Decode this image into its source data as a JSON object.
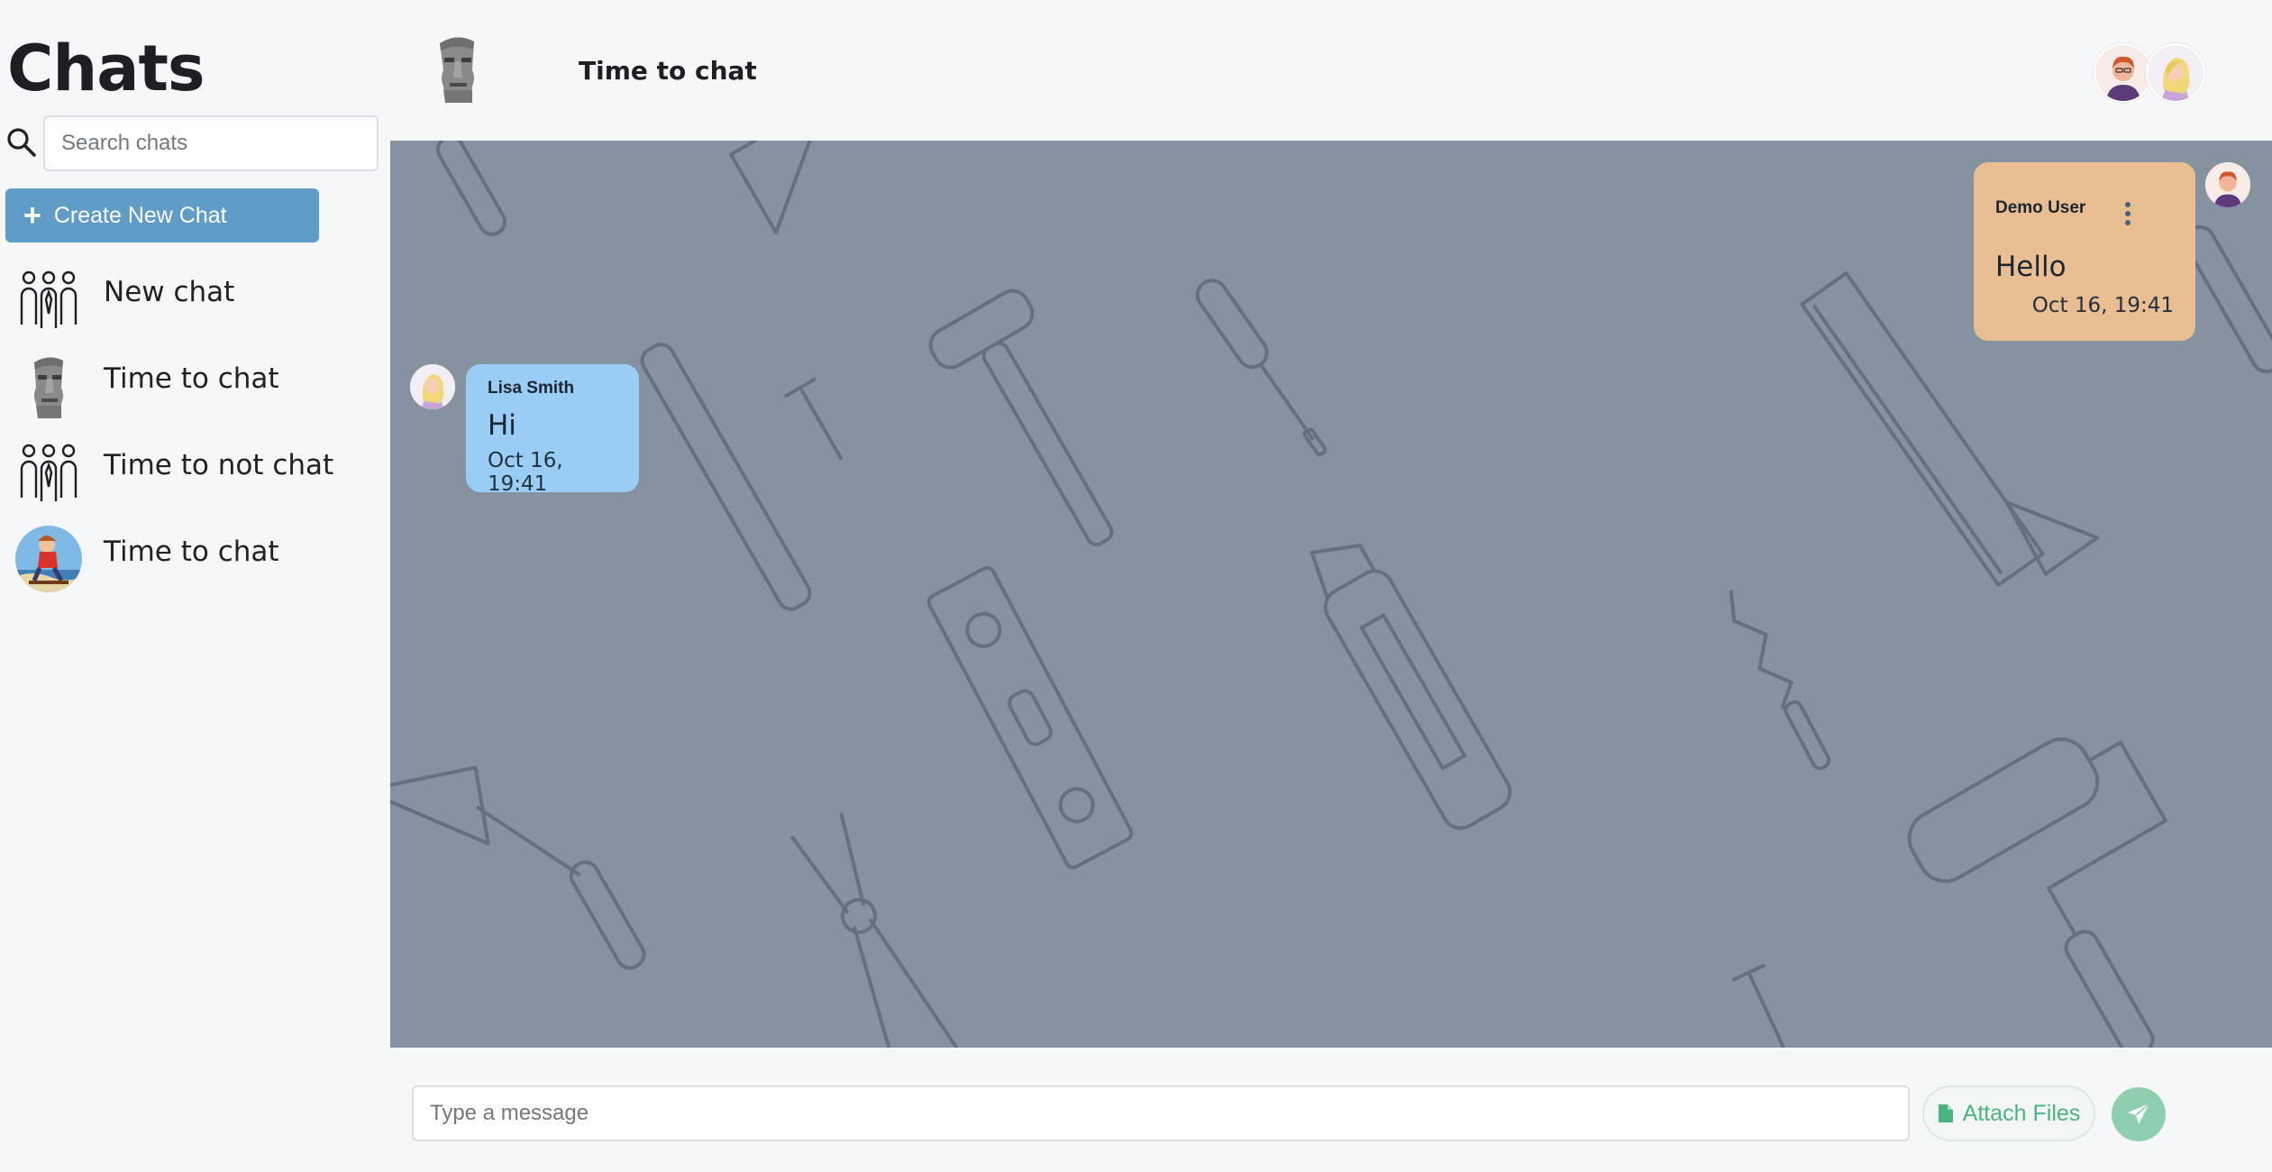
{
  "sidebar": {
    "title": "Chats",
    "search": {
      "placeholder": "Search chats",
      "value": ""
    },
    "create_button_label": "Create New Chat",
    "chats": [
      {
        "label": "New chat",
        "icon": "group-icon"
      },
      {
        "label": "Time to chat",
        "icon": "moai-icon"
      },
      {
        "label": "Time to not chat",
        "icon": "group-icon"
      },
      {
        "label": "Time to chat",
        "icon": "skater-avatar-icon"
      }
    ]
  },
  "header": {
    "title": "Time to chat",
    "avatar_icon": "moai-icon",
    "participants": [
      "red-hair-man-avatar",
      "blonde-woman-avatar"
    ]
  },
  "messages": [
    {
      "author": "Lisa Smith",
      "text": "Hi",
      "time": "Oct 16, 19:41",
      "direction": "incoming",
      "color": "#9acdf6"
    },
    {
      "author": "Demo User",
      "text": "Hello",
      "time": "Oct 16, 19:41",
      "direction": "outgoing",
      "color": "#e9be93"
    }
  ],
  "composer": {
    "placeholder": "Type a message",
    "value": "",
    "attach_label": "Attach Files",
    "send_icon": "paper-plane-icon"
  },
  "colors": {
    "accent": "#5f9dc7",
    "chat_background": "#8692a0",
    "incoming_bubble": "#9acdf6",
    "outgoing_bubble": "#e9be93",
    "send_button": "#8fcfae"
  }
}
